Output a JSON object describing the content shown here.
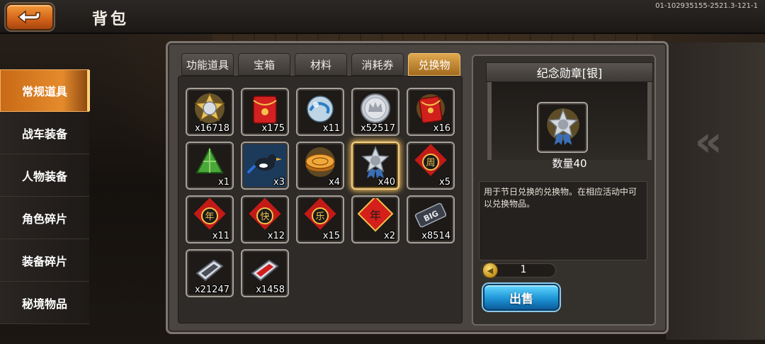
{
  "header": {
    "title": "背包",
    "version": "01-102935155-2521.3-121-1"
  },
  "sidebar": {
    "items": [
      {
        "label": "常规道具",
        "active": true
      },
      {
        "label": "战车装备",
        "active": false
      },
      {
        "label": "人物装备",
        "active": false
      },
      {
        "label": "角色碎片",
        "active": false
      },
      {
        "label": "装备碎片",
        "active": false
      },
      {
        "label": "秘境物品",
        "active": false
      }
    ]
  },
  "tabs": [
    {
      "label": "功能道具",
      "active": false
    },
    {
      "label": "宝箱",
      "active": false
    },
    {
      "label": "材料",
      "active": false
    },
    {
      "label": "消耗券",
      "active": false
    },
    {
      "label": "兑换物",
      "active": true
    }
  ],
  "items": [
    {
      "icon": "silver-star-medal-icon",
      "qty": "x16718"
    },
    {
      "icon": "red-envelope-icon",
      "qty": "x175"
    },
    {
      "icon": "blue-dragon-orb-icon",
      "qty": "x11"
    },
    {
      "icon": "silver-crown-coin-icon",
      "qty": "x52517"
    },
    {
      "icon": "red-lucky-envelope-icon",
      "qty": "x16"
    },
    {
      "icon": "zongzi-icon",
      "qty": "x1"
    },
    {
      "icon": "magpie-icon",
      "qty": "x3"
    },
    {
      "icon": "mooncake-icon",
      "qty": "x4"
    },
    {
      "icon": "commemorative-medal-silver-icon",
      "qty": "x40",
      "selected": true
    },
    {
      "icon": "zhou-character-tile-icon",
      "qty": "x5"
    },
    {
      "icon": "nian-character-tile-icon",
      "qty": "x11"
    },
    {
      "icon": "kuai-character-tile-icon",
      "qty": "x12"
    },
    {
      "icon": "le-character-tile-icon",
      "qty": "x15"
    },
    {
      "icon": "nian-red-card-icon",
      "qty": "x2"
    },
    {
      "icon": "big-chip-icon",
      "qty": "x8514"
    },
    {
      "icon": "silver-plate-icon",
      "qty": "x21247"
    },
    {
      "icon": "red-plate-icon",
      "qty": "x1458"
    }
  ],
  "detail": {
    "title": "纪念勋章[银]",
    "icon": "commemorative-medal-silver-icon",
    "quantity_label": "数量40",
    "description": "用于节日兑换的兑换物。在相应活动中可以兑换物品。",
    "stepper_value": "1",
    "sell_label": "出售"
  },
  "colors": {
    "accent_orange": "#e58b2c",
    "tab_active": "#e0a84f",
    "sell_button": "#1e95d6",
    "selected_glow": "#e7b657"
  }
}
